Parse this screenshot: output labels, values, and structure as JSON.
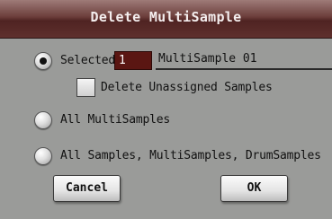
{
  "dialog": {
    "title": "Delete MultiSample",
    "options": [
      {
        "label": "Selected",
        "selected": true
      },
      {
        "label": "All MultiSamples",
        "selected": false
      },
      {
        "label": "All Samples, MultiSamples, DrumSamples",
        "selected": false
      }
    ],
    "selected_number": "1",
    "selected_name": "MultiSample 01",
    "checkbox": {
      "label": "Delete Unassigned Samples",
      "checked": false
    },
    "cancel_label": "Cancel",
    "ok_label": "OK"
  }
}
